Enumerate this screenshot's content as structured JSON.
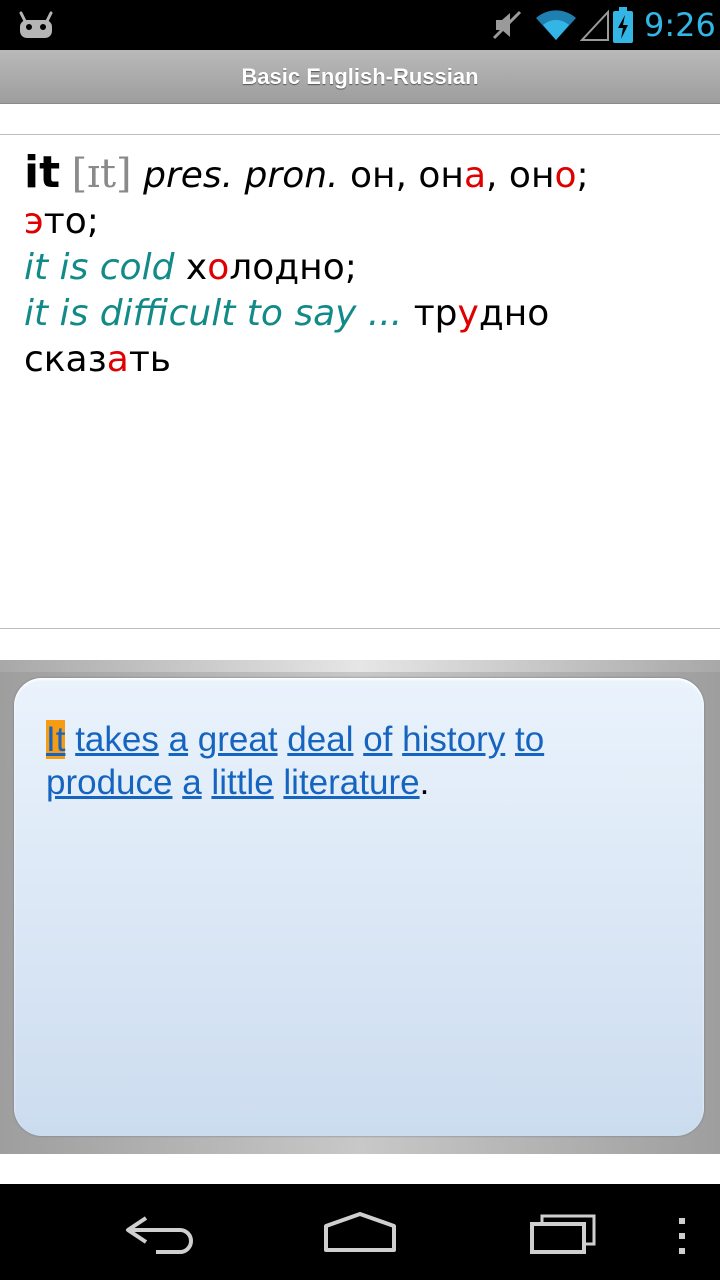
{
  "status_bar": {
    "time": "9:26",
    "icons": [
      "android-icon",
      "mute-icon",
      "wifi-icon",
      "signal-icon",
      "battery-icon"
    ],
    "clock_color": "#33b5e5"
  },
  "app": {
    "title": "Basic English-Russian"
  },
  "entry": {
    "headword": "it",
    "transcription": "[ɪt]",
    "pos": "pres. pron.",
    "tr1_parts": [
      "он, он",
      "а",
      ", он",
      "о",
      ";"
    ],
    "tr2_parts": [
      "э",
      "то;"
    ],
    "example1": "it is cold",
    "example1_tr_parts": [
      "х",
      "о",
      "лодно;"
    ],
    "example2": "it is difficult to say ...",
    "example2_tr_parts": [
      "тр",
      "у",
      "дно"
    ],
    "example2_tr2_parts": [
      "сказ",
      "а",
      "ть"
    ],
    "colors": {
      "example": "#118a88",
      "stress": "#e00000",
      "transcription": "#8a8a8a"
    }
  },
  "quote": {
    "words": [
      "It",
      "takes",
      "a",
      "great",
      "deal",
      "of",
      "history",
      "to",
      "produce",
      "a",
      "little",
      "literature"
    ],
    "trailing_punct": ".",
    "highlighted_word": "It",
    "link_color": "#1565c0",
    "highlight_color": "#f59b14"
  },
  "nav_bar": {
    "icons": [
      "back-icon",
      "home-icon",
      "recent-apps-icon",
      "overflow-menu-icon"
    ]
  }
}
